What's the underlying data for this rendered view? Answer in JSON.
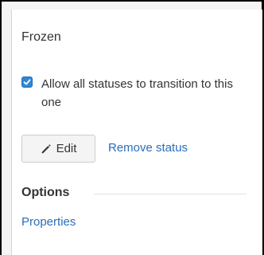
{
  "status": {
    "name": "Frozen"
  },
  "transition_option": {
    "checked": true,
    "label": "Allow all statuses to transition to this one"
  },
  "actions": {
    "edit_label": "Edit",
    "remove_label": "Remove status"
  },
  "options": {
    "heading": "Options",
    "properties_label": "Properties"
  },
  "colors": {
    "link": "#2a6ebb",
    "checkbox": "#2e86d6",
    "text": "#333333"
  },
  "icons": {
    "edit": "pencil-icon",
    "checkbox": "checkmark-icon"
  }
}
